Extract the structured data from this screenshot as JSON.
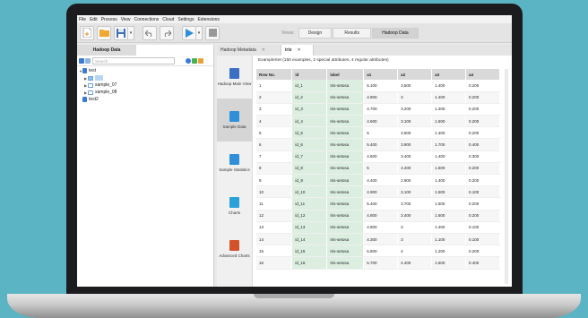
{
  "menu": [
    "File",
    "Edit",
    "Process",
    "View",
    "Connections",
    "Cloud",
    "Settings",
    "Extensions"
  ],
  "toolbar": {
    "icons": [
      "new-process-icon",
      "open-icon",
      "save-icon",
      "undo-icon",
      "redo-icon",
      "run-icon",
      "stop-icon"
    ],
    "views_label": "Views:",
    "views": [
      "Design",
      "Results",
      "Hadoop Data"
    ],
    "active_view": "Hadoop Data"
  },
  "left_panel": {
    "tab": "Hadoop Data",
    "search_placeholder": "Search",
    "tree": [
      {
        "label": "test",
        "kind": "repo"
      },
      {
        "label": "",
        "kind": "table"
      },
      {
        "label": "sample_07",
        "kind": "table"
      },
      {
        "label": "sample_08",
        "kind": "table"
      },
      {
        "label": "test2",
        "kind": "repo"
      }
    ]
  },
  "right_panel": {
    "tabs": [
      {
        "label": "Hadoop Metadata",
        "close": "✕"
      },
      {
        "label": "iris",
        "close": "✕"
      }
    ],
    "nav": [
      {
        "label": "Hadoop Main View",
        "icon": "hadoop-main-view-icon",
        "color": "#3a6fc4"
      },
      {
        "label": "Sample Data",
        "icon": "sample-data-icon",
        "color": "#2f8fd8"
      },
      {
        "label": "Sample Statistics",
        "icon": "sample-statistics-icon",
        "color": "#2f8fd8"
      },
      {
        "label": "Charts",
        "icon": "charts-icon",
        "color": "#2aa1d8"
      },
      {
        "label": "Advanced Charts",
        "icon": "advanced-charts-icon",
        "color": "#d2532b"
      }
    ],
    "summary": "ExampleSet (150 examples, 2 special attributes, 4 regular attributes)",
    "table": {
      "headers": [
        "Row No.",
        "id",
        "label",
        "a1",
        "a2",
        "a3",
        "a4"
      ],
      "rows": [
        [
          "1",
          "id_1",
          "Iris-setosa",
          "5.100",
          "3.500",
          "1.400",
          "0.200"
        ],
        [
          "2",
          "id_2",
          "Iris-setosa",
          "4.900",
          "3",
          "1.400",
          "0.200"
        ],
        [
          "3",
          "id_3",
          "Iris-setosa",
          "4.700",
          "3.200",
          "1.300",
          "0.200"
        ],
        [
          "4",
          "id_4",
          "Iris-setosa",
          "4.600",
          "3.100",
          "1.500",
          "0.200"
        ],
        [
          "5",
          "id_5",
          "Iris-setosa",
          "5",
          "3.600",
          "1.400",
          "0.200"
        ],
        [
          "6",
          "id_6",
          "Iris-setosa",
          "5.400",
          "3.900",
          "1.700",
          "0.400"
        ],
        [
          "7",
          "id_7",
          "Iris-setosa",
          "4.600",
          "3.400",
          "1.400",
          "0.300"
        ],
        [
          "8",
          "id_8",
          "Iris-setosa",
          "5",
          "3.400",
          "1.500",
          "0.200"
        ],
        [
          "9",
          "id_9",
          "Iris-setosa",
          "4.400",
          "2.900",
          "1.400",
          "0.200"
        ],
        [
          "10",
          "id_10",
          "Iris-setosa",
          "4.900",
          "3.100",
          "1.500",
          "0.100"
        ],
        [
          "11",
          "id_11",
          "Iris-setosa",
          "5.400",
          "3.700",
          "1.500",
          "0.200"
        ],
        [
          "12",
          "id_12",
          "Iris-setosa",
          "4.800",
          "3.400",
          "1.600",
          "0.200"
        ],
        [
          "13",
          "id_13",
          "Iris-setosa",
          "4.800",
          "3",
          "1.400",
          "0.100"
        ],
        [
          "14",
          "id_14",
          "Iris-setosa",
          "4.300",
          "3",
          "1.100",
          "0.100"
        ],
        [
          "15",
          "id_15",
          "Iris-setosa",
          "5.800",
          "4",
          "1.200",
          "0.200"
        ],
        [
          "16",
          "id_16",
          "Iris-setosa",
          "5.700",
          "4.400",
          "1.500",
          "0.400"
        ]
      ]
    }
  },
  "colors": {
    "background": "#5bb4c4",
    "special_column": "#dbeee0",
    "header": "#d9d9d9"
  }
}
